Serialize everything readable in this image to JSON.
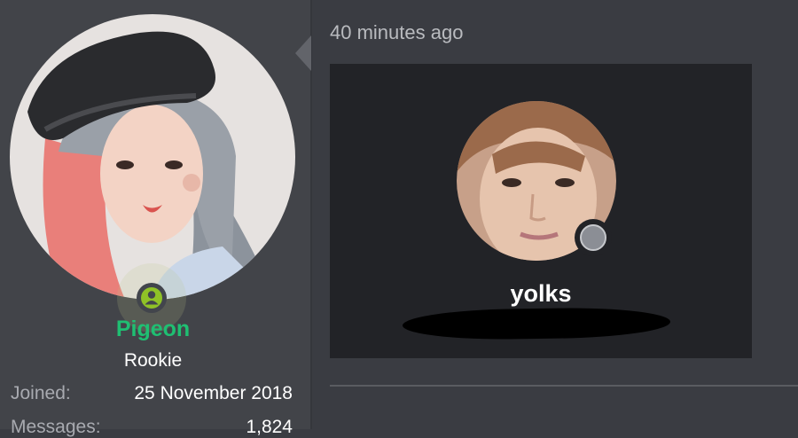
{
  "profile": {
    "username": "Pigeon",
    "user_title": "Rookie",
    "stats": [
      {
        "label": "Joined:",
        "value": "25 November 2018"
      },
      {
        "label": "Messages:",
        "value": "1,824"
      }
    ]
  },
  "post": {
    "timestamp": "40 minutes ago",
    "embed": {
      "name": "yolks"
    }
  },
  "colors": {
    "username": "#1fbf72",
    "online_status": "#8fc227",
    "sidebar_bg": "#424449",
    "content_bg": "#3a3c42",
    "embed_bg": "#222327"
  },
  "icons": {
    "online_status": "person-icon",
    "offline_status": "status-dot-icon"
  }
}
